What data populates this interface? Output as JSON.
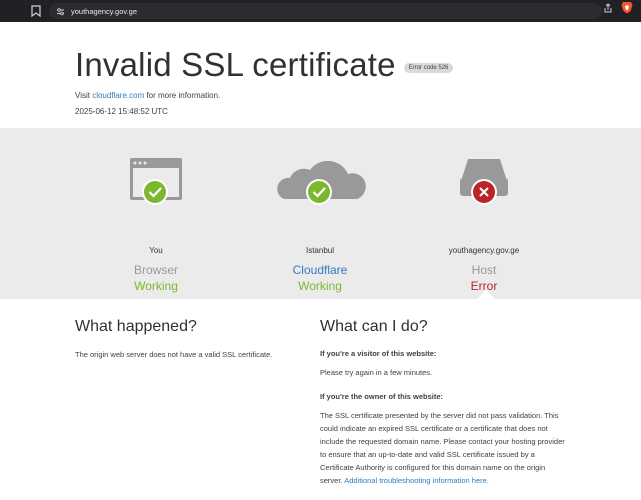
{
  "browser": {
    "url": "youthagency.gov.ge"
  },
  "header": {
    "title": "Invalid SSL certificate",
    "error_badge": "Error code 526",
    "visit_prefix": "Visit ",
    "visit_link": "cloudflare.com",
    "visit_suffix": " for more information.",
    "timestamp": "2025-06-12 15:48:52 UTC"
  },
  "diagram": {
    "nodes": [
      {
        "location": "You",
        "role": "Browser",
        "status": "Working",
        "state": "ok",
        "icon": "browser-icon"
      },
      {
        "location": "Istanbul",
        "role": "Cloudflare",
        "status": "Working",
        "state": "ok",
        "icon": "cloud-icon"
      },
      {
        "location": "youthagency.gov.ge",
        "role": "Host",
        "status": "Error",
        "state": "error",
        "icon": "server-icon"
      }
    ]
  },
  "what_happened": {
    "heading": "What happened?",
    "text": "The origin web server does not have a valid SSL certificate."
  },
  "what_can_i_do": {
    "heading": "What can I do?",
    "visitor_heading": "If you're a visitor of this website:",
    "visitor_text": "Please try again in a few minutes.",
    "owner_heading": "If you're the owner of this website:",
    "owner_text": "The SSL certificate presented by the server did not pass validation. This could indicate an expired SSL certificate or a certificate that does not include the requested domain name. Please contact your hosting provider to ensure that an up-to-date and valid SSL certificate issued by a Certificate Authority is configured for this domain name on the origin server. ",
    "owner_link": "Additional troubleshooting information here."
  },
  "colors": {
    "ok": "#7cb82f",
    "error": "#bd2426",
    "link": "#2f7bbf",
    "band": "#ebebeb"
  }
}
